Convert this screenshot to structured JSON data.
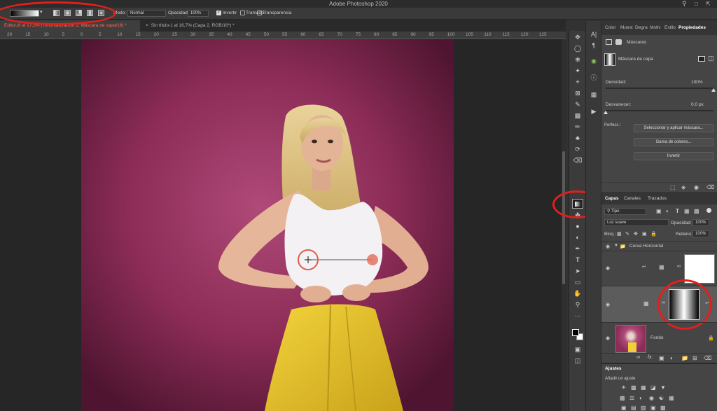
{
  "app": {
    "title": "Adobe Photoshop 2020"
  },
  "options": {
    "mode_label": "Modo:",
    "mode_value": "Normal",
    "opacity_label": "Opacidad:",
    "opacity_value": "100%",
    "invert_label": "Invertir",
    "dither_label": "Tramado",
    "transparency_label": "Transparencia"
  },
  "tabs": [
    {
      "label": "Editor.tif al 17,3% (Tono/saturación 1, Máscara de capa/16) *"
    },
    {
      "label": "Sin título-1 al 16,7% (Capa 2, RGB/16*) *"
    }
  ],
  "ruler": [
    "20",
    "15",
    "10",
    "5",
    "0",
    "5",
    "10",
    "15",
    "20",
    "25",
    "30",
    "35",
    "40",
    "45",
    "50",
    "55",
    "60",
    "65",
    "70",
    "75",
    "80",
    "85",
    "90",
    "95",
    "100",
    "105",
    "110",
    "115",
    "120",
    "125"
  ],
  "properties": {
    "tabs": [
      "Color",
      "Muest",
      "Degra",
      "Motiv",
      "Estilo",
      "Propiedades"
    ],
    "masks_label": "Máscaras",
    "layer_mask_label": "Máscara de capa",
    "density_label": "Densidad:",
    "density_value": "100%",
    "feather_label": "Desvanecer:",
    "feather_value": "0,0 px",
    "refine_label": "Perfecc.:",
    "select_mask_button": "Seleccionar y aplicar máscara...",
    "color_range_button": "Gama de colores...",
    "invert_button": "Invertir",
    "density_fraction": 1.0,
    "feather_fraction": 0.0
  },
  "layers_panel": {
    "tabs": [
      "Capas",
      "Canales",
      "Trazados"
    ],
    "filter_label": "Tipo",
    "blend_mode": "Luz suave",
    "opacity_label": "Opacidad:",
    "opacity_value": "100%",
    "lock_label": "Bloq.:",
    "fill_label": "Relleno:",
    "fill_value": "100%",
    "group_name": "Curva Horizontal",
    "background_name": "Fondo"
  },
  "adjustments": {
    "title": "Ajustes",
    "add_label": "Añadir un ajuste"
  },
  "colors": {
    "backdrop": "#8c2c57",
    "accent_red": "#e0201c",
    "active_tab": "#ff6b4f"
  }
}
